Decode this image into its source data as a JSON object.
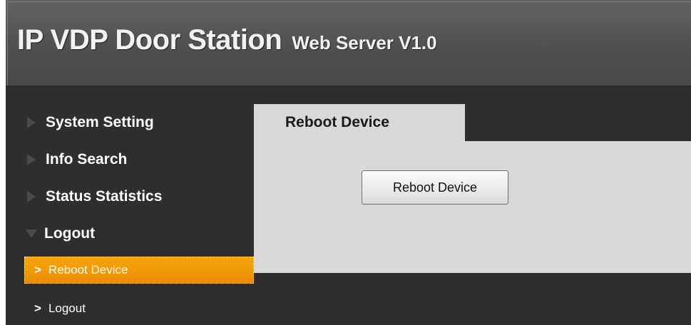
{
  "header": {
    "title": "IP VDP Door Station",
    "subtitle": "Web Server V1.0"
  },
  "sidebar": {
    "items": [
      {
        "label": "System Setting",
        "icon": "triangle-right-icon",
        "expanded": false
      },
      {
        "label": "Info Search",
        "icon": "triangle-right-icon",
        "expanded": false
      },
      {
        "label": "Status Statistics",
        "icon": "triangle-right-icon",
        "expanded": false
      },
      {
        "label": "Logout",
        "icon": "triangle-down-icon",
        "expanded": true
      }
    ],
    "subitems": [
      {
        "label": "Reboot Device",
        "icon": "chevron-right-icon",
        "active": true
      },
      {
        "label": "Logout",
        "icon": "chevron-right-icon",
        "active": false
      }
    ]
  },
  "main": {
    "tab_label": "Reboot Device",
    "button_label": "Reboot Device"
  },
  "colors": {
    "accent": "#f29b06",
    "background": "#2e2e2e",
    "panel": "#d9d9d9"
  }
}
